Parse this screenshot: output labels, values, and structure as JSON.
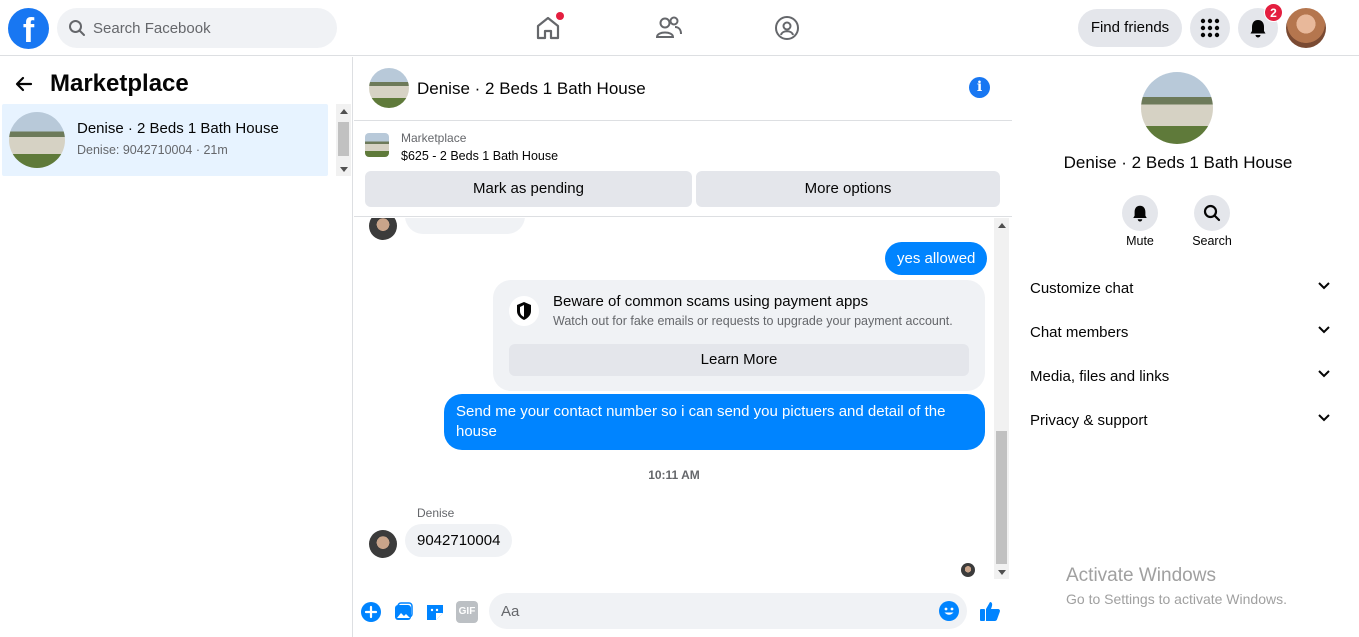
{
  "topbar": {
    "logo": "f",
    "search_placeholder": "Search Facebook",
    "find_friends_label": "Find friends",
    "notification_count": "2",
    "icons": [
      "home-icon",
      "friends-icon",
      "groups-icon",
      "menu-grid-icon",
      "bell-icon"
    ]
  },
  "sidebar": {
    "title": "Marketplace",
    "conversations": [
      {
        "name": "Denise · 2 Beds 1 Bath House",
        "preview": "Denise: 9042710004 · 21m"
      }
    ]
  },
  "chat": {
    "title": "Denise · 2 Beds 1 Bath House",
    "listing": {
      "source": "Marketplace",
      "summary": "$625 - 2 Beds 1 Bath House",
      "mark_pending_label": "Mark as pending",
      "more_options_label": "More options"
    },
    "messages": {
      "out_1": "yes allowed",
      "scam_title": "Beware of common scams using payment apps",
      "scam_desc": "Watch out for fake emails or requests to upgrade your payment account.",
      "learn_more_label": "Learn More",
      "out_2": "Send me your contact number so i can send you pictuers and detail of the house",
      "timestamp": "10:11 AM",
      "sender_name": "Denise",
      "in_1": "9042710004"
    },
    "composer": {
      "placeholder": "Aa",
      "gif_label": "GIF"
    }
  },
  "details": {
    "title": "Denise · 2 Beds 1 Bath House",
    "mute_label": "Mute",
    "search_label": "Search",
    "sections": [
      "Customize chat",
      "Chat members",
      "Media, files and links",
      "Privacy & support"
    ]
  },
  "watermark": {
    "line1": "Activate Windows",
    "line2": "Go to Settings to activate Windows."
  },
  "colors": {
    "brand": "#1877f2",
    "bubble_out": "#0084ff",
    "selected_row": "#e7f3ff",
    "badge": "#e41e3f"
  }
}
